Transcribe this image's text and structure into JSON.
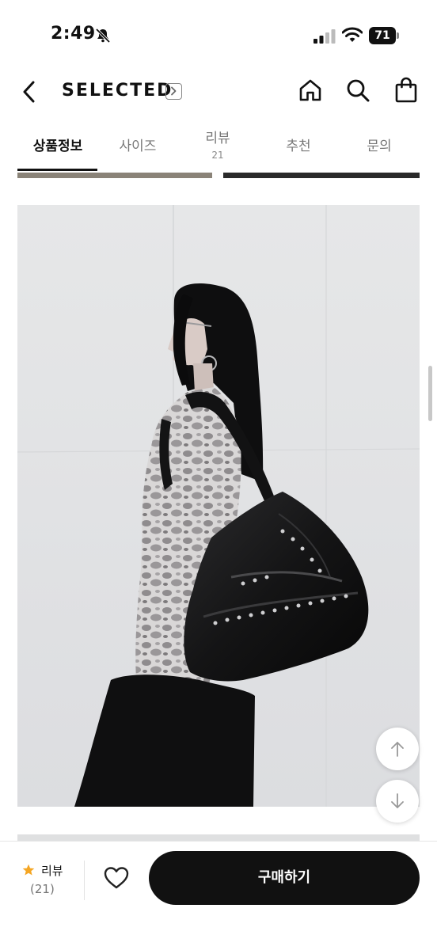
{
  "status_bar": {
    "time": "2:49",
    "battery": "71",
    "icons": [
      "bell-slash-icon",
      "signal-icon",
      "wifi-icon",
      "battery-icon"
    ]
  },
  "header": {
    "brand": "SELECTED",
    "icons": [
      "back-icon",
      "chevron-right-icon",
      "home-icon",
      "search-icon",
      "shopping-bag-icon"
    ]
  },
  "tabs": [
    {
      "label": "상품정보",
      "active": true
    },
    {
      "label": "사이즈"
    },
    {
      "label": "리뷰",
      "count": "21"
    },
    {
      "label": "추천"
    },
    {
      "label": "문의"
    }
  ],
  "content": {
    "photo_icons": [
      "product-photo"
    ],
    "scroll_buttons": [
      "arrow-up-icon",
      "arrow-down-icon"
    ]
  },
  "bottom_bar": {
    "review_label": "리뷰",
    "review_count": "(21)",
    "buy_label": "구매하기",
    "icons": [
      "star-icon",
      "heart-icon"
    ],
    "colors": {
      "star": "#f5a623",
      "buy_button": "#111111"
    }
  }
}
